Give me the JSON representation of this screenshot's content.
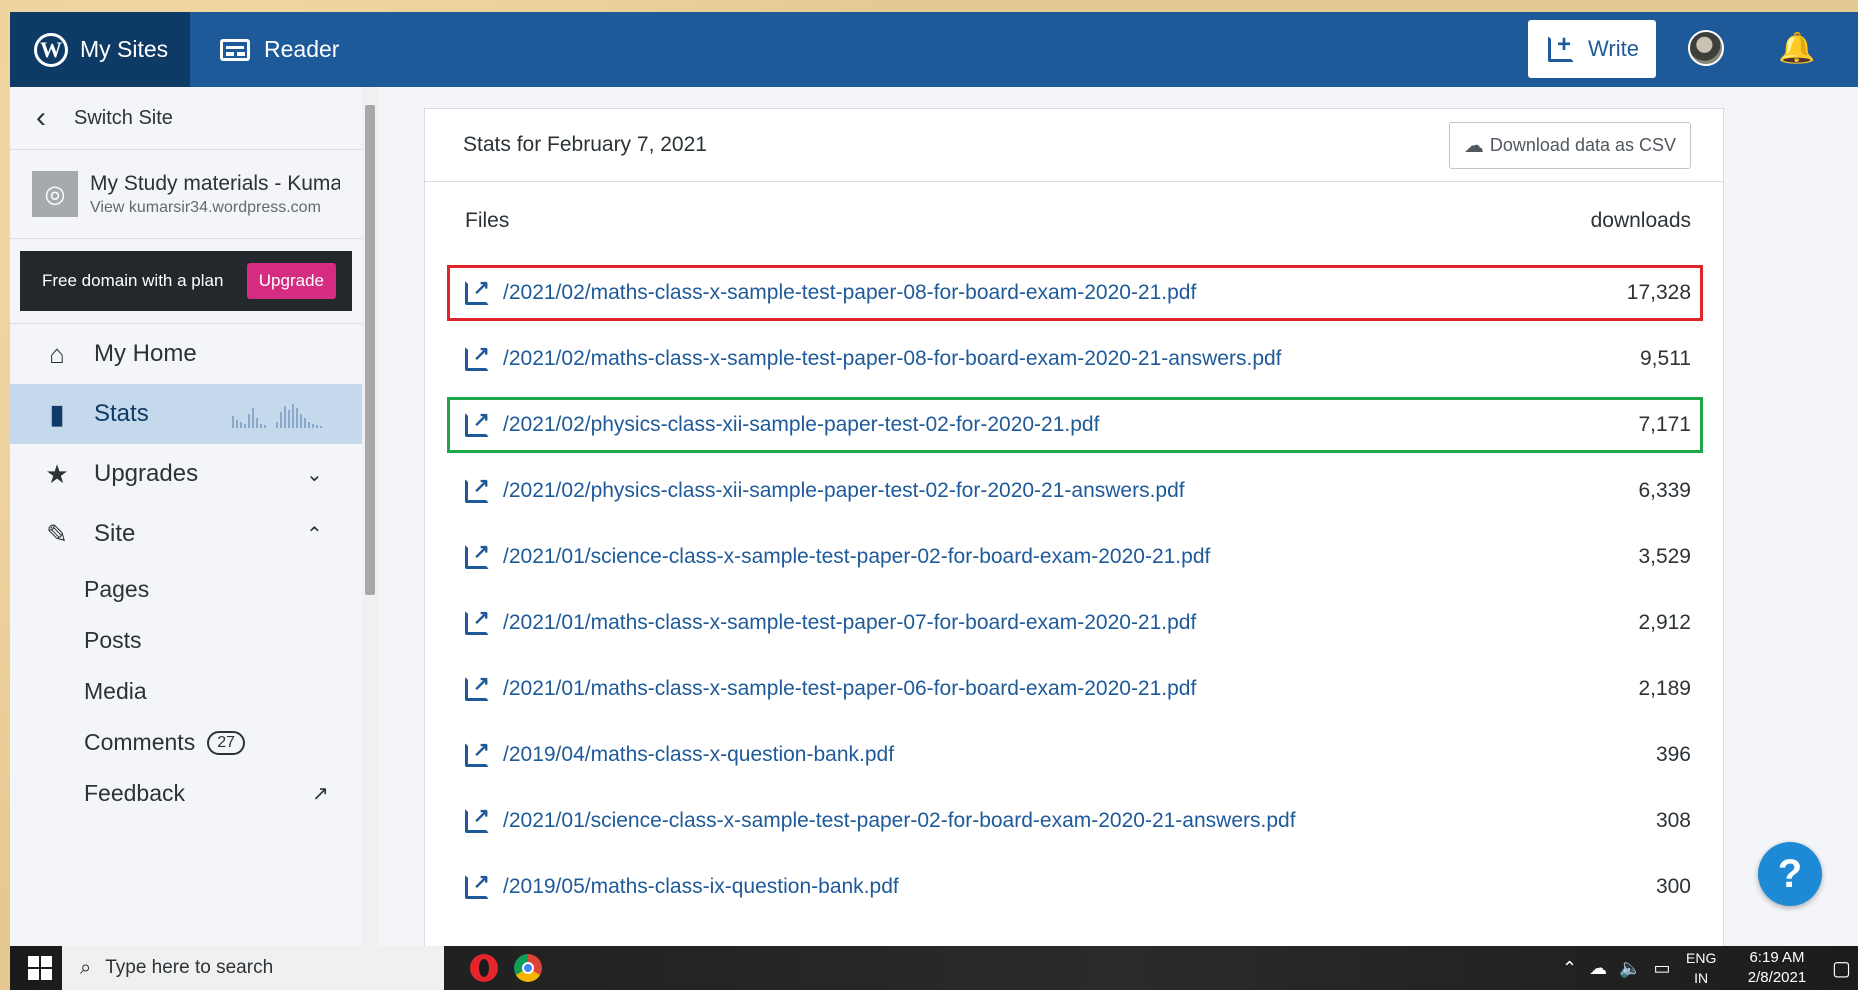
{
  "topbar": {
    "my_sites": "My Sites",
    "reader": "Reader",
    "write": "Write"
  },
  "sidebar": {
    "switch_site": "Switch Site",
    "site_title": "My Study materials - Kumar",
    "site_url": "View kumarsir34.wordpress.com",
    "promo_text": "Free domain with a plan",
    "promo_button": "Upgrade",
    "items": [
      {
        "label": "My Home",
        "icon": "home-icon"
      },
      {
        "label": "Stats",
        "icon": "bar-chart-icon",
        "active": true
      },
      {
        "label": "Upgrades",
        "icon": "star-icon",
        "caret": "⌄"
      },
      {
        "label": "Site",
        "icon": "pencil-icon",
        "caret": "⌃"
      }
    ],
    "sub_items": [
      "Pages",
      "Posts",
      "Media",
      "Comments",
      "Feedback"
    ],
    "comments_count": "27"
  },
  "stats": {
    "title": "Stats for February 7, 2021",
    "csv_button": "Download data as CSV",
    "col_files": "Files",
    "col_downloads": "downloads",
    "rows": [
      {
        "file": "/2021/02/maths-class-x-sample-test-paper-08-for-board-exam-2020-21.pdf",
        "downloads": "17,328",
        "highlight": "red"
      },
      {
        "file": "/2021/02/maths-class-x-sample-test-paper-08-for-board-exam-2020-21-answers.pdf",
        "downloads": "9,511"
      },
      {
        "file": "/2021/02/physics-class-xii-sample-paper-test-02-for-2020-21.pdf",
        "downloads": "7,171",
        "highlight": "green"
      },
      {
        "file": "/2021/02/physics-class-xii-sample-paper-test-02-for-2020-21-answers.pdf",
        "downloads": "6,339"
      },
      {
        "file": "/2021/01/science-class-x-sample-test-paper-02-for-board-exam-2020-21.pdf",
        "downloads": "3,529"
      },
      {
        "file": "/2021/01/maths-class-x-sample-test-paper-07-for-board-exam-2020-21.pdf",
        "downloads": "2,912"
      },
      {
        "file": "/2021/01/maths-class-x-sample-test-paper-06-for-board-exam-2020-21.pdf",
        "downloads": "2,189"
      },
      {
        "file": "/2019/04/maths-class-x-question-bank.pdf",
        "downloads": "396"
      },
      {
        "file": "/2021/01/science-class-x-sample-test-paper-02-for-board-exam-2020-21-answers.pdf",
        "downloads": "308"
      },
      {
        "file": "/2019/05/maths-class-ix-question-bank.pdf",
        "downloads": "300"
      }
    ]
  },
  "help_label": "?",
  "taskbar": {
    "search_placeholder": "Type here to search",
    "lang": "ENG",
    "region": "IN",
    "time": "6:19 AM",
    "date": "2/8/2021"
  },
  "colors": {
    "brand": "#1e5a9a",
    "highlight_red": "#e0242a",
    "highlight_green": "#1ea64a",
    "upgrade": "#d52c82"
  }
}
